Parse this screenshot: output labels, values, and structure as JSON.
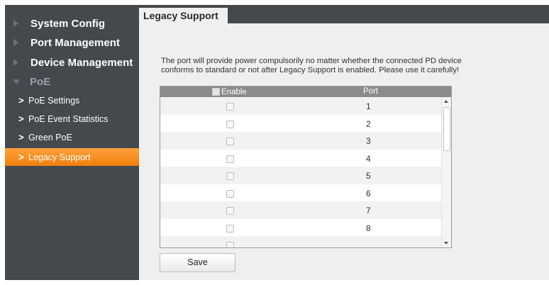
{
  "sidebar": {
    "items": [
      {
        "label": "System Config"
      },
      {
        "label": "Port Management"
      },
      {
        "label": "Device Management"
      },
      {
        "label": "PoE"
      }
    ],
    "poe_subitems": [
      {
        "label": "PoE Settings"
      },
      {
        "label": "PoE Event Statistics"
      },
      {
        "label": "Green PoE"
      },
      {
        "label": "Legacy Support"
      }
    ]
  },
  "tab": {
    "label": "Legacy Support"
  },
  "notice": {
    "line1": "The port will provide power compulsorily no matter whether the connected PD device",
    "line2": "conforms to standard or not after Legacy Support is enabled. Please use it carefully!"
  },
  "table": {
    "headers": {
      "enable": "Enable",
      "port": "Port"
    },
    "rows": [
      {
        "port": "1"
      },
      {
        "port": "2"
      },
      {
        "port": "3"
      },
      {
        "port": "4"
      },
      {
        "port": "5"
      },
      {
        "port": "6"
      },
      {
        "port": "7"
      },
      {
        "port": "8"
      }
    ]
  },
  "buttons": {
    "save": "Save"
  },
  "colors": {
    "sidebar_bg": "#44494e",
    "active_item": "#f7901e",
    "content_bg": "#efefef",
    "table_header": "#8b8b8b"
  }
}
